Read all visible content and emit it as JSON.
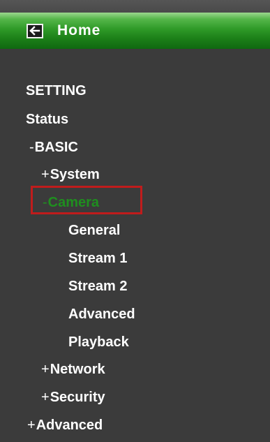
{
  "home": {
    "label": "Home",
    "icon": "back-arrow-icon"
  },
  "menu": {
    "setting": "SETTING",
    "status": "Status",
    "basic": {
      "prefix": "-",
      "label": "BASIC"
    },
    "system": {
      "prefix": "+",
      "label": "System"
    },
    "camera": {
      "prefix": "-",
      "label": "Camera",
      "selected": true,
      "children": [
        "General",
        "Stream 1",
        "Stream 2",
        "Advanced",
        "Playback"
      ]
    },
    "network": {
      "prefix": "+",
      "label": "Network"
    },
    "security": {
      "prefix": "+",
      "label": "Security"
    },
    "advanced": {
      "prefix": "+",
      "label": "Advanced"
    }
  },
  "colors": {
    "panel_background": "#3b3b3b",
    "header_green": "#2f9a28",
    "selected_text": "#1f8f1f",
    "selection_border": "#c01c1c",
    "menu_text": "#ffffff"
  }
}
